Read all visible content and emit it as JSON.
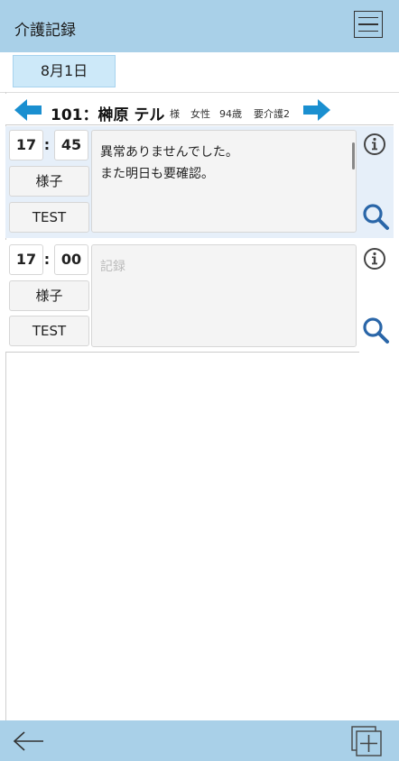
{
  "header": {
    "title": "介護記録",
    "menu_icon": "hamburger-menu-icon"
  },
  "date": {
    "label": "8月1日"
  },
  "resident": {
    "room_name": "101：榊原 テル",
    "honorific": "様",
    "gender": "女性",
    "age": "94歳",
    "care_level": "要介護2",
    "prev_icon": "arrow-left-icon",
    "next_icon": "arrow-right-icon"
  },
  "records": [
    {
      "hour": "17",
      "sep": ":",
      "minute": "45",
      "category": "様子",
      "staff": "TEST",
      "note_line1": "異常ありませんでした。",
      "note_line2": "また明日も要確認。",
      "note_placeholder": ""
    },
    {
      "hour": "17",
      "sep": ":",
      "minute": "00",
      "category": "様子",
      "staff": "TEST",
      "note_line1": "",
      "note_line2": "",
      "note_placeholder": "記録"
    }
  ],
  "footer": {
    "back_icon": "back-arrow-icon",
    "add_icon": "add-record-icon"
  },
  "colors": {
    "header_bg": "#a9d0e8",
    "accent_blue": "#1a8fd0",
    "date_bg": "#cde9f9",
    "selected_row_bg": "#e6eff9"
  }
}
